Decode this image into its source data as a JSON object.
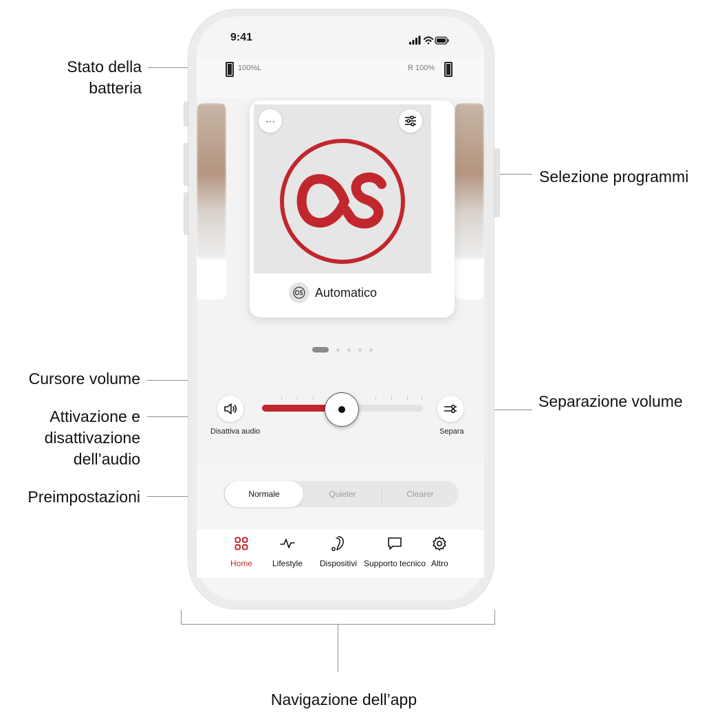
{
  "callouts": {
    "battery": {
      "line1": "Stato della",
      "line2": "batteria"
    },
    "program_selection": "Selezione programmi",
    "volume_cursor": "Cursore volume",
    "mute": {
      "line1": "Attivazione e",
      "line2": "disattivazione",
      "line3": "dell’audio"
    },
    "volume_split": "Separazione volume",
    "presets": "Preimpostazioni",
    "app_navigation": "Navigazione dell’app"
  },
  "status_bar": {
    "time": "9:41"
  },
  "battery": {
    "left_label": "100%L",
    "right_label": "R 100%"
  },
  "program_card": {
    "more_label": "···",
    "program_name": "Automatico"
  },
  "volume": {
    "mute_caption": "Disattiva audio",
    "split_caption": "Separa",
    "level_fraction": 0.5
  },
  "presets": {
    "items": [
      "Normale",
      "Quieter",
      "Clearer"
    ],
    "selected": "Normale"
  },
  "nav": {
    "items": [
      "Home",
      "Lifestyle",
      "Dispositivi",
      "Supporto tecnico",
      "Altro"
    ],
    "active": "Home"
  },
  "colors": {
    "accent": "#c1272d",
    "connector": "#8c8c8c"
  }
}
